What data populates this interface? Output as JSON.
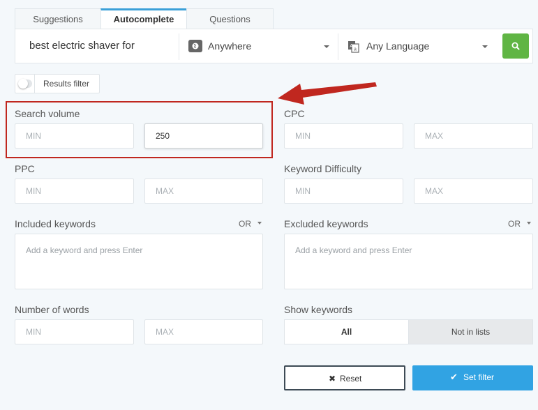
{
  "tabs": [
    "Suggestions",
    "Autocomplete",
    "Questions"
  ],
  "active_tab": "Autocomplete",
  "search": {
    "query": "best electric shaver for",
    "location": "Anywhere",
    "language": "Any Language"
  },
  "results_filter": {
    "label": "Results filter",
    "enabled": false
  },
  "filters": {
    "search_volume": {
      "label": "Search volume",
      "min_placeholder": "MIN",
      "max_value": "250"
    },
    "cpc": {
      "label": "CPC",
      "min_placeholder": "MIN",
      "max_placeholder": "MAX"
    },
    "ppc": {
      "label": "PPC",
      "min_placeholder": "MIN",
      "max_placeholder": "MAX"
    },
    "keyword_difficulty": {
      "label": "Keyword Difficulty",
      "min_placeholder": "MIN",
      "max_placeholder": "MAX"
    },
    "included_keywords": {
      "label": "Included keywords",
      "operator": "OR",
      "placeholder": "Add a keyword and press Enter"
    },
    "excluded_keywords": {
      "label": "Excluded keywords",
      "operator": "OR",
      "placeholder": "Add a keyword and press Enter"
    },
    "number_of_words": {
      "label": "Number of words",
      "min_placeholder": "MIN",
      "max_placeholder": "MAX"
    },
    "show_keywords": {
      "label": "Show keywords",
      "options": [
        "All",
        "Not in lists"
      ],
      "selected": "All"
    }
  },
  "actions": {
    "reset": "Reset",
    "set_filter": "Set filter"
  },
  "colors": {
    "accent_tab": "#3aa0d8",
    "search_button": "#60b544",
    "set_filter_button": "#31a3e3",
    "highlight_box": "#c0271f",
    "arrow": "#c0271f"
  },
  "icons": {
    "location": "globe-icon",
    "language": "translate-icon",
    "search": "search-icon",
    "reset": "close-icon",
    "set_filter": "checkmark-icon"
  }
}
